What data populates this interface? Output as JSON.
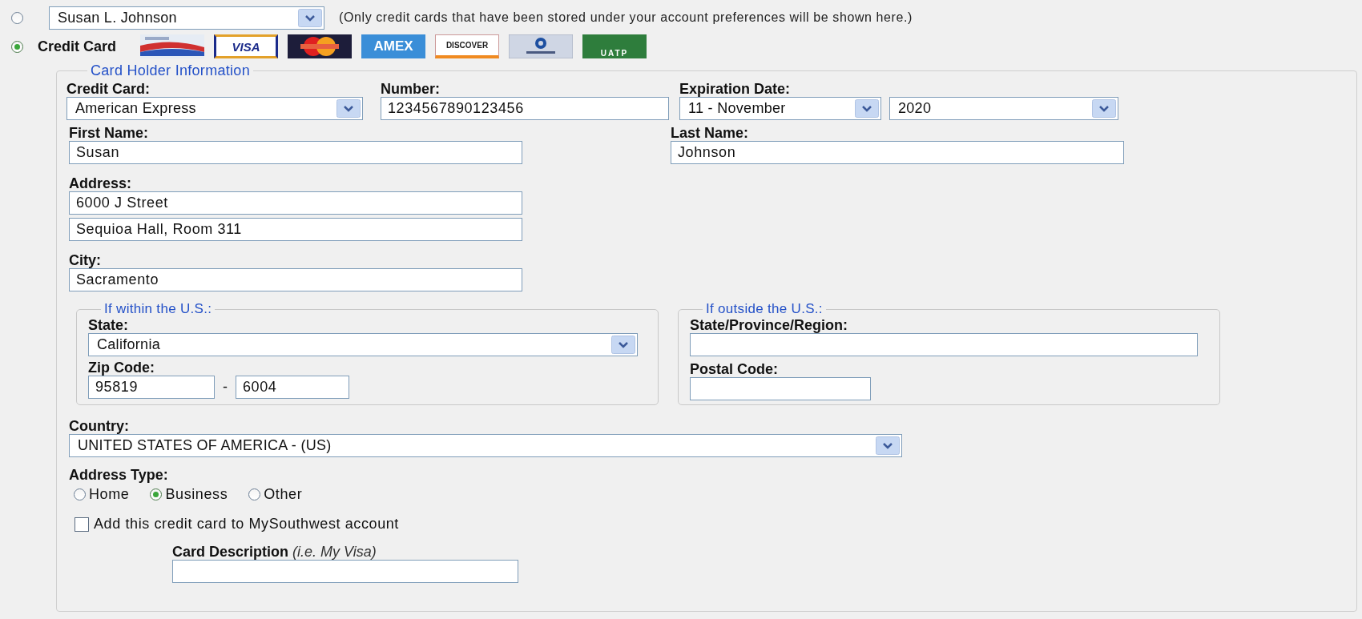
{
  "stored_card": {
    "selected": false,
    "value": "Susan L. Johnson",
    "note": "(Only credit cards that have been stored under your account preferences will be shown here.)"
  },
  "credit_card_option": {
    "selected": true,
    "label": "Credit Card",
    "logos": [
      {
        "kind": "southwest"
      },
      {
        "kind": "visa",
        "text": "VISA"
      },
      {
        "kind": "mastercard"
      },
      {
        "kind": "amex",
        "text": "AMEX"
      },
      {
        "kind": "discover",
        "text": "DISCOVER"
      },
      {
        "kind": "diners"
      },
      {
        "kind": "uatp",
        "text": "UATP"
      }
    ]
  },
  "card_holder": {
    "legend": "Card Holder Information",
    "credit_card": {
      "label": "Credit Card:",
      "value": "American Express"
    },
    "number": {
      "label": "Number:",
      "value": "1234567890123456"
    },
    "expiration": {
      "label": "Expiration Date:",
      "month": "11 - November",
      "year": "2020"
    },
    "first_name": {
      "label": "First Name:",
      "value": "Susan"
    },
    "last_name": {
      "label": "Last Name:",
      "value": "Johnson"
    },
    "address": {
      "label": "Address:",
      "lines": [
        "6000 J Street",
        "Sequioa Hall, Room 311"
      ]
    },
    "city": {
      "label": "City:",
      "value": "Sacramento"
    },
    "within_us": {
      "legend": "If within the U.S.:",
      "state": {
        "label": "State:",
        "value": "California"
      },
      "zip": {
        "label": "Zip Code:",
        "value": "95819",
        "separator": "-",
        "extension": "6004"
      }
    },
    "outside_us": {
      "legend": "If outside the U.S.:",
      "region": {
        "label": "State/Province/Region:"
      },
      "postal_code": {
        "label": "Postal Code:"
      }
    },
    "country": {
      "label": "Country:",
      "value": "UNITED STATES OF AMERICA - (US)"
    },
    "address_type": {
      "label": "Address Type:",
      "options": [
        {
          "label": "Home",
          "selected": false
        },
        {
          "label": "Business",
          "selected": true
        },
        {
          "label": "Other",
          "selected": false
        }
      ]
    },
    "save_card": {
      "label": "Add this credit card to MySouthwest account",
      "checked": false
    },
    "card_description": {
      "label": "**Card Description** *(i.e. My Visa)*"
    }
  }
}
